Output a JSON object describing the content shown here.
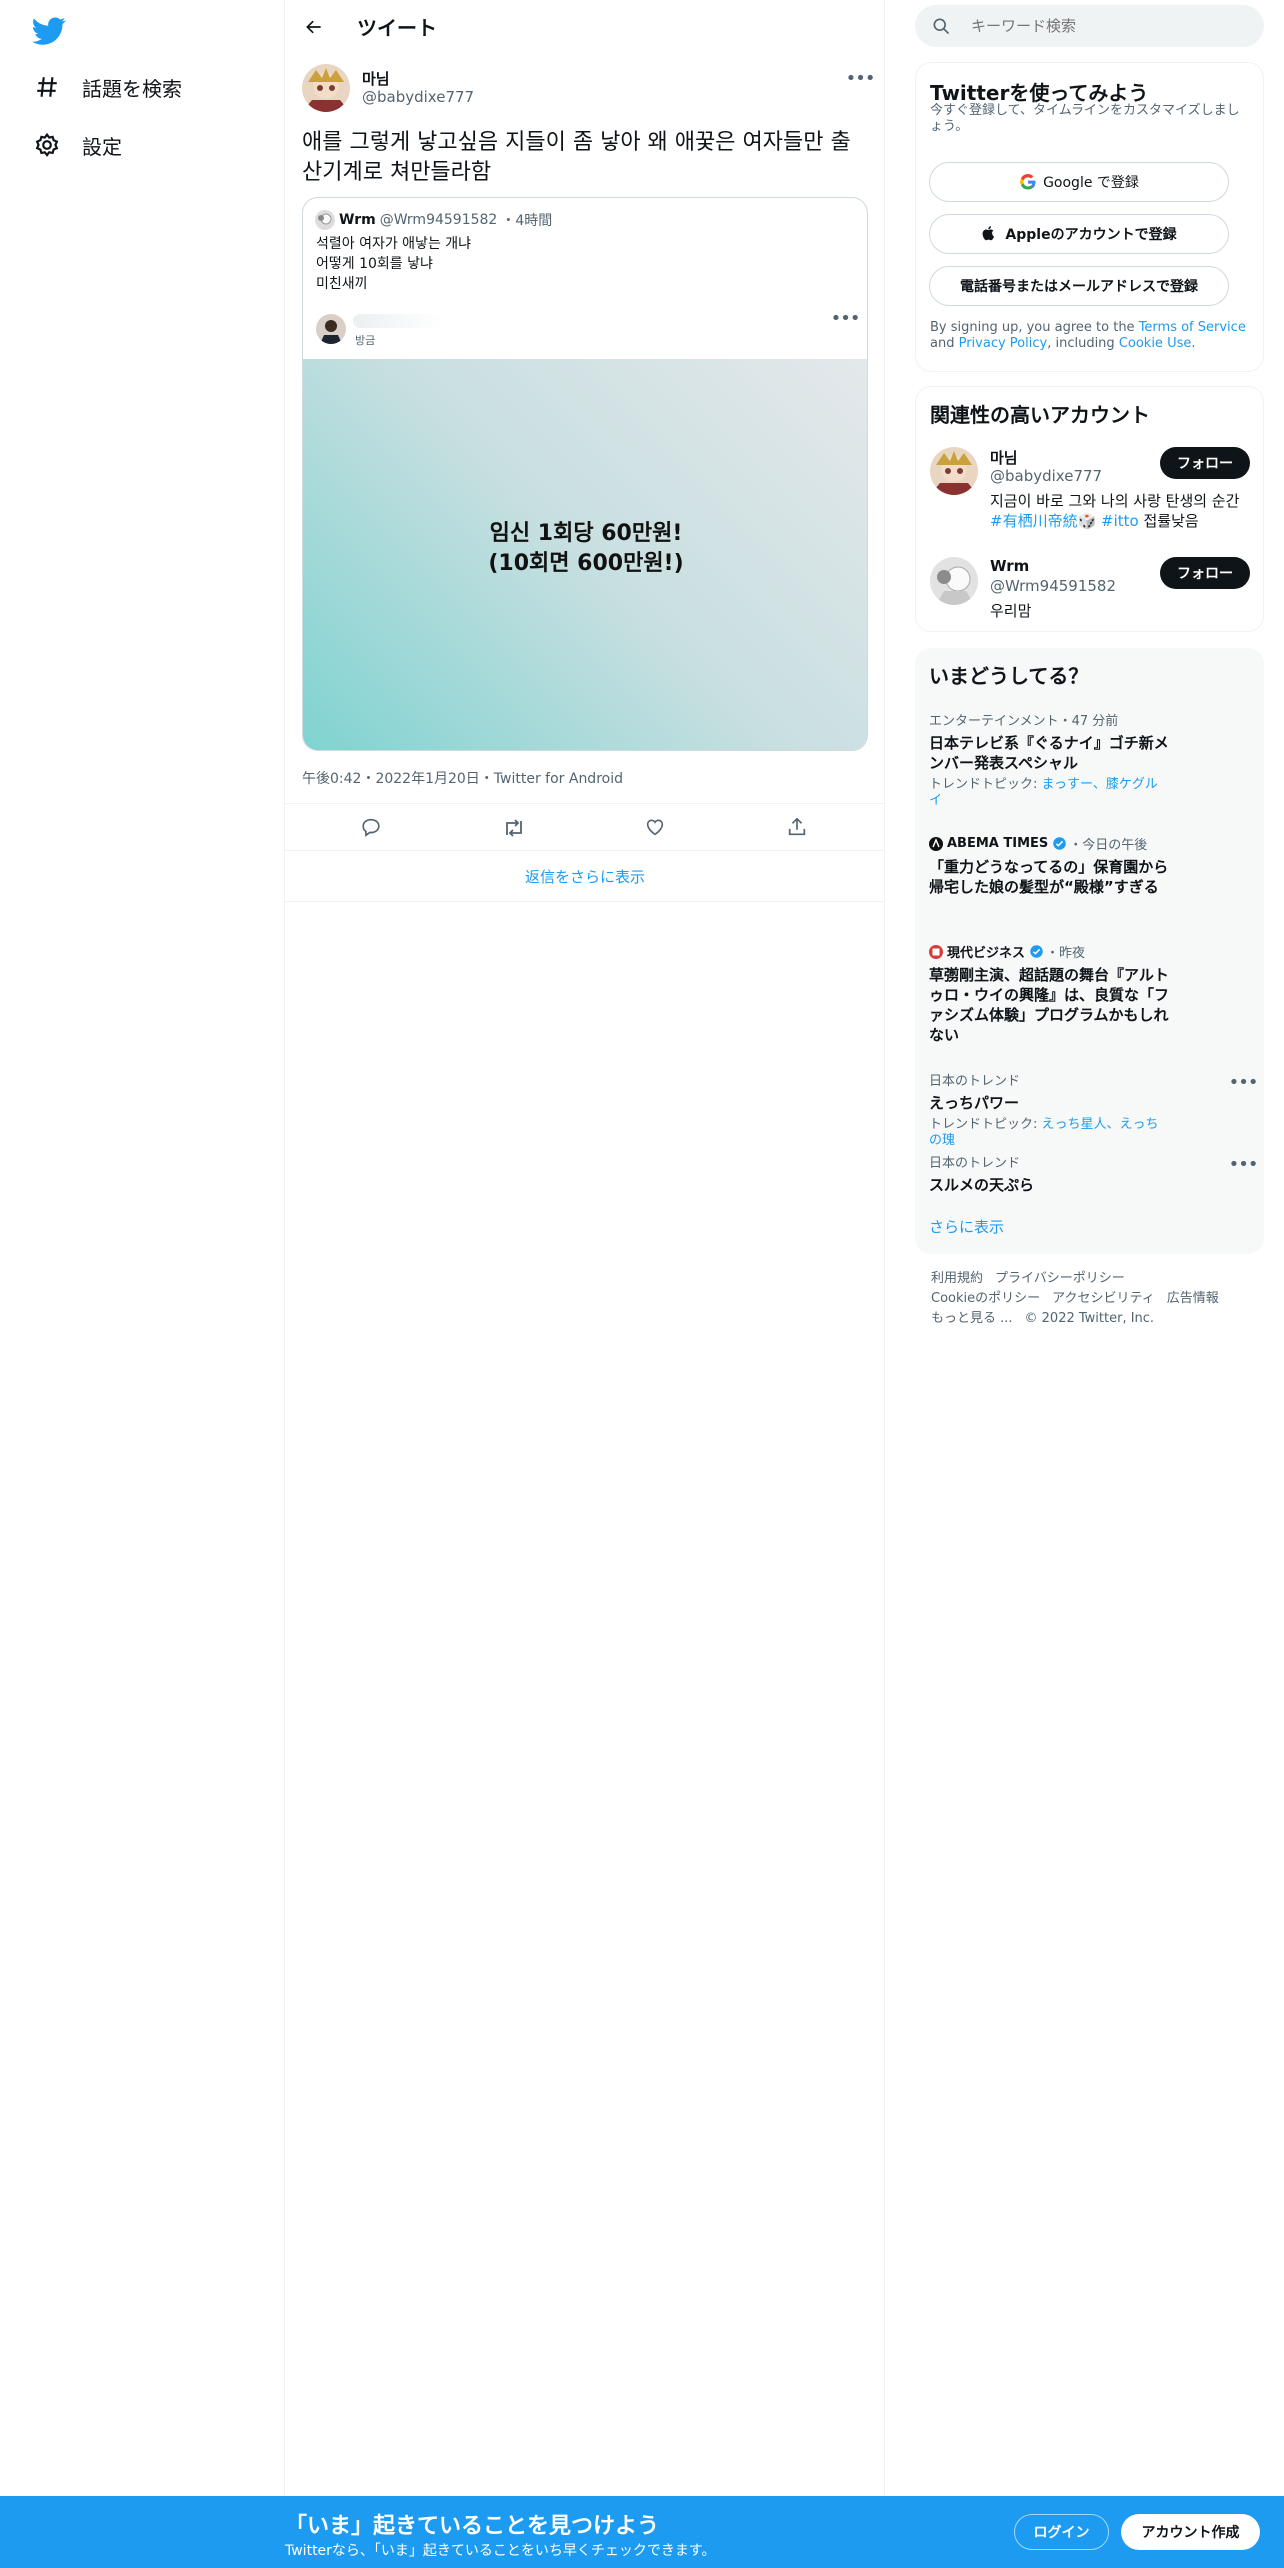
{
  "colors": {
    "accent": "#1d9bf0",
    "text": "#0f1419",
    "muted": "#536471",
    "bottom_bar": "#1d9bf0"
  },
  "left_nav": {
    "logo_icon": "twitter-bird-icon",
    "items": [
      {
        "icon": "hashtag-icon",
        "label": "話題を検索"
      },
      {
        "icon": "gear-icon",
        "label": "設定"
      }
    ]
  },
  "header": {
    "back_icon": "arrow-left-icon",
    "title": "ツイート"
  },
  "tweet": {
    "author_name": "마님",
    "author_handle": "@babydixe777",
    "text": "애를 그렇게 낳고싶음 지들이 좀 낳아 왜 애꿎은 여자들만 출산기계로 쳐만들라함",
    "quote": {
      "name": "Wrm",
      "handle": "@Wrm94591582",
      "time": "4時間",
      "text": "석렬아 여자가 애낳는 개냐\n어떻게 10회를 낳냐\n미친새끼",
      "card_label": "방금",
      "media_caption": "임신 1회당 60만원!\n(10회면 600만원!)"
    },
    "timestamp": "午後0:42・2022年1月20日・Twitter for Android",
    "actions": [
      "reply-icon",
      "retweet-icon",
      "like-icon",
      "share-icon"
    ],
    "show_more_replies": "返信をさらに表示"
  },
  "search": {
    "placeholder": "キーワード検索"
  },
  "signup_panel": {
    "title": "Twitterを使ってみよう",
    "subtitle": "今すぐ登録して、タイムラインをカスタマイズしましょう。",
    "google_button": "Google で登録",
    "apple_button": "Appleのアカウントで登録",
    "phone_button": "電話番号またはメールアドレスで登録",
    "terms_prefix": "By signing up, you agree to the ",
    "terms_link": "Terms of Service",
    "terms_and": " and ",
    "privacy_link": "Privacy Policy",
    "terms_including": ", including ",
    "cookie_link": "Cookie Use",
    "terms_end": "."
  },
  "relevant_accounts": {
    "title": "関連性の高いアカウント",
    "accounts": [
      {
        "name": "마님",
        "handle": "@babydixe777",
        "bio_text": "지금이 바로 그와 나의 사랑 탄생의 순간 ",
        "bio_tag1": "#有栖川帝統",
        "bio_emoji": "🎲",
        "bio_tag2": "#itto",
        "bio_tail": " 접률낮음",
        "follow_label": "フォロー"
      },
      {
        "name": "Wrm",
        "handle": "@Wrm94591582",
        "bio_text": "우리맘",
        "follow_label": "フォロー"
      }
    ]
  },
  "trends": {
    "title": "いまどうしてる？",
    "items": [
      {
        "meta": "エンターテインメント・47 分前",
        "title": "日本テレビ系『ぐるナイ』ゴチ新メンバー発表スペシャル",
        "topic_prefix": "トレンドトピック: ",
        "topic_links": "まっすー、膝ケグルイ"
      },
      {
        "source": "ABEMA TIMES",
        "meta": "・今日の午後",
        "title": "「重力どうなってるの」保育園から帰宅した娘の髪型が“殿様”すぎる"
      },
      {
        "source": "現代ビジネス",
        "meta": "・昨夜",
        "title": "草彅剛主演、超話題の舞台『アルトゥロ・ウイの興隆』は、良質な「ファシズム体験」プログラムかもしれない"
      },
      {
        "meta": "日本のトレンド",
        "title": "えっちパワー",
        "topic_prefix": "トレンドトピック: ",
        "topic_links": "えっち星人、えっちの瑰"
      },
      {
        "meta": "日本のトレンド",
        "title": "スルメの天ぷら"
      }
    ],
    "show_more": "さらに表示"
  },
  "footer": {
    "links": [
      "利用規約",
      "プライバシーポリシー",
      "Cookieのポリシー",
      "アクセシビリティ",
      "広告情報",
      "もっと見る ..."
    ],
    "copyright": "© 2022 Twitter, Inc."
  },
  "bottom_bar": {
    "title": "「いま」起きていることを見つけよう",
    "subtitle": "Twitterなら、「いま」起きていることをいち早くチェックできます。",
    "login": "ログイン",
    "signup": "アカウント作成"
  }
}
